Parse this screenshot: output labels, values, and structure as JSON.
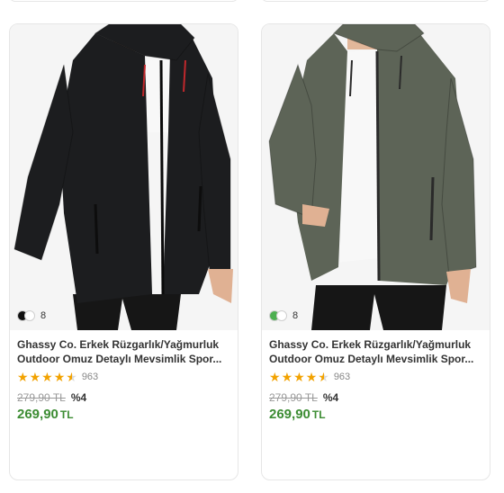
{
  "products": [
    {
      "title_line1": "Ghassy Co. Erkek Rüzgarlık/Yağmurluk",
      "title_line2": "Outdoor Omuz Detaylı Mevsimlik Spor...",
      "swatch_colors": [
        "#111111",
        "#ffffff"
      ],
      "color_count": "8",
      "rating_count": "963",
      "old_price": "279,90 TL",
      "discount": "%4",
      "new_price": "269,90",
      "currency": "TL",
      "jacket_color": "#1c1d1f",
      "zip_accent": "#c0282c"
    },
    {
      "title_line1": "Ghassy Co. Erkek Rüzgarlık/Yağmurluk",
      "title_line2": "Outdoor Omuz Detaylı Mevsimlik Spor...",
      "swatch_colors": [
        "#4caf50",
        "#ffffff"
      ],
      "color_count": "8",
      "rating_count": "963",
      "old_price": "279,90 TL",
      "discount": "%4",
      "new_price": "269,90",
      "currency": "TL",
      "jacket_color": "#5d6457",
      "zip_accent": "#2a2a2a"
    }
  ],
  "rating_value": 4.5,
  "colors": {
    "price_green": "#3c8c33",
    "star": "#f2a200"
  }
}
